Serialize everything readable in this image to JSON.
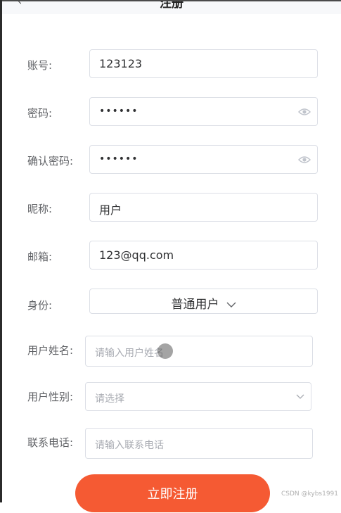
{
  "header": {
    "back_glyph": "‹",
    "title": "注册"
  },
  "form": {
    "account": {
      "label": "账号:",
      "value": "123123"
    },
    "password": {
      "label": "密码:",
      "value": "••••••",
      "toggle_icon": "eye-icon"
    },
    "confirm_password": {
      "label": "确认密码:",
      "value": "••••••",
      "toggle_icon": "eye-icon"
    },
    "nickname": {
      "label": "昵称:",
      "value": "用户"
    },
    "email": {
      "label": "邮箱:",
      "value": "123@qq.com"
    },
    "identity": {
      "label": "身份:",
      "selected": "普通用户"
    },
    "real_name": {
      "label": "用户姓名:",
      "placeholder": "请输入用户姓名"
    },
    "gender": {
      "label": "用户性别:",
      "placeholder": "请选择"
    },
    "phone": {
      "label": "联系电话:",
      "placeholder": "请输入联系电话"
    }
  },
  "submit_label": "立即注册",
  "watermark": "CSDN @kybs1991",
  "colors": {
    "accent": "#f55a33",
    "border": "#dcdfe6",
    "placeholder": "#a8abb2",
    "label": "#606266"
  }
}
